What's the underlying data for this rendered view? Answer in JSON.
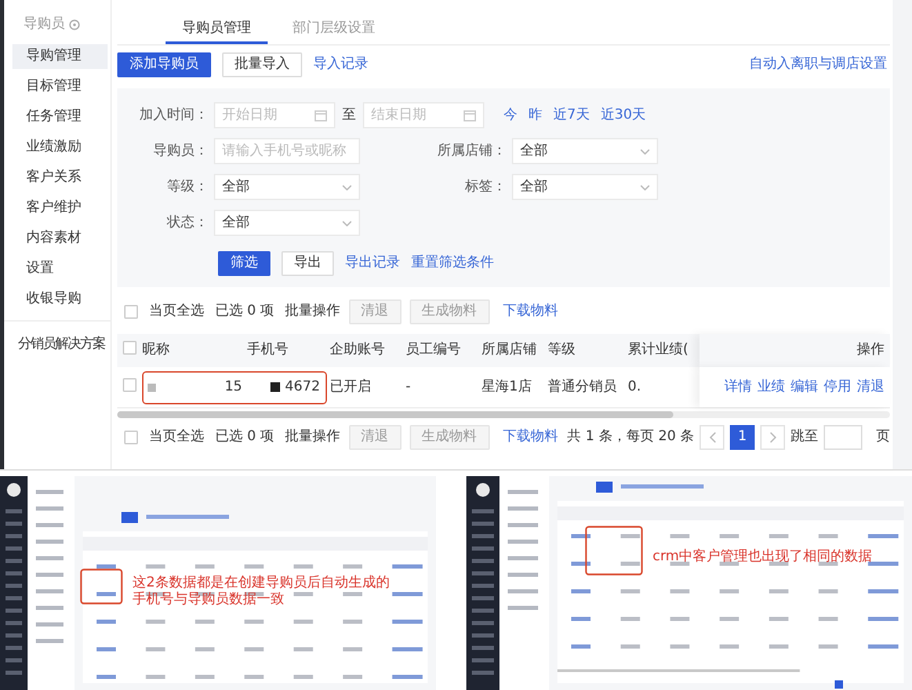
{
  "sidebar": {
    "title": "导购员",
    "items": [
      {
        "label": "导购管理",
        "selected": true
      },
      {
        "label": "目标管理",
        "selected": false
      },
      {
        "label": "任务管理",
        "selected": false
      },
      {
        "label": "业绩激励",
        "selected": false
      },
      {
        "label": "客户关系",
        "selected": false
      },
      {
        "label": "客户维护",
        "selected": false
      },
      {
        "label": "内容素材",
        "selected": false
      },
      {
        "label": "设置",
        "selected": false
      },
      {
        "label": "收银导购",
        "selected": false
      }
    ],
    "footer_items": [
      {
        "label": "分销员解决方案",
        "selected": false
      }
    ]
  },
  "tabs": [
    {
      "label": "导购员管理",
      "selected": true
    },
    {
      "label": "部门层级设置",
      "selected": false
    }
  ],
  "toolbar": {
    "primary_button": "添加导购员",
    "button": "批量导入",
    "link": "导入记录",
    "right_link": "自动入离职与调店设置"
  },
  "filters": {
    "date": {
      "label": "加入时间：",
      "start_placeholder": "开始日期",
      "separator": "至",
      "end_placeholder": "结束日期",
      "quick": [
        "今",
        "昨",
        "近7天",
        "近30天"
      ]
    },
    "fields": [
      {
        "kind": "input",
        "label": "导购员：",
        "placeholder": "请输入手机号或昵称"
      },
      {
        "kind": "select",
        "label": "所属店铺：",
        "value": "全部"
      },
      {
        "kind": "select",
        "label": "等级：",
        "value": "全部"
      },
      {
        "kind": "select",
        "label": "标签：",
        "value": "全部"
      },
      {
        "kind": "select",
        "label": "状态：",
        "value": "全部"
      }
    ],
    "primary_button": "筛选",
    "button": "导出",
    "links": [
      "导出记录",
      "重置筛选条件"
    ]
  },
  "batch_bars": [
    {
      "select_all": {
        "label": "当页全选",
        "checked": false
      },
      "selected_count": "已选 0 项",
      "batch_label": "批量操作",
      "buttons": [
        {
          "label": "清退",
          "disabled": true
        },
        {
          "label": "生成物料",
          "disabled": true
        }
      ],
      "link": "下载物料"
    },
    {
      "select_all": {
        "label": "当页全选",
        "checked": false
      },
      "selected_count": "已选 0 项",
      "batch_label": "批量操作",
      "buttons": [
        {
          "label": "清退",
          "disabled": true
        },
        {
          "label": "生成物料",
          "disabled": true
        }
      ],
      "link": "下载物料"
    }
  ],
  "table": {
    "header_checked": false,
    "columns": [
      "昵称",
      "手机号",
      "企助账号",
      "员工编号",
      "所属店铺",
      "等级",
      "累计业绩(",
      "操作"
    ],
    "rows": [
      {
        "checked": false,
        "phone_start": "15",
        "phone_end": "4672",
        "assistant_account": "已开启",
        "employee_no": "-",
        "store": "星海1店",
        "level": "普通分销员",
        "total_sales": "0.",
        "actions": [
          "详情",
          "业绩",
          "编辑",
          "停用",
          "清退"
        ]
      }
    ]
  },
  "pagination": {
    "summary": "共 1 条，每页 20 条",
    "pages": [
      {
        "label": "1",
        "selected": true
      }
    ],
    "jump_label": "跳至",
    "jump_suffix": "页"
  },
  "screenshots": [
    {
      "annotation": [
        "这2条数据都是在创建导购员后自动生成的",
        "手机号与导购员数据一致"
      ]
    },
    {
      "annotation": [
        "crm中客户管理也出现了相同的数据"
      ]
    }
  ]
}
